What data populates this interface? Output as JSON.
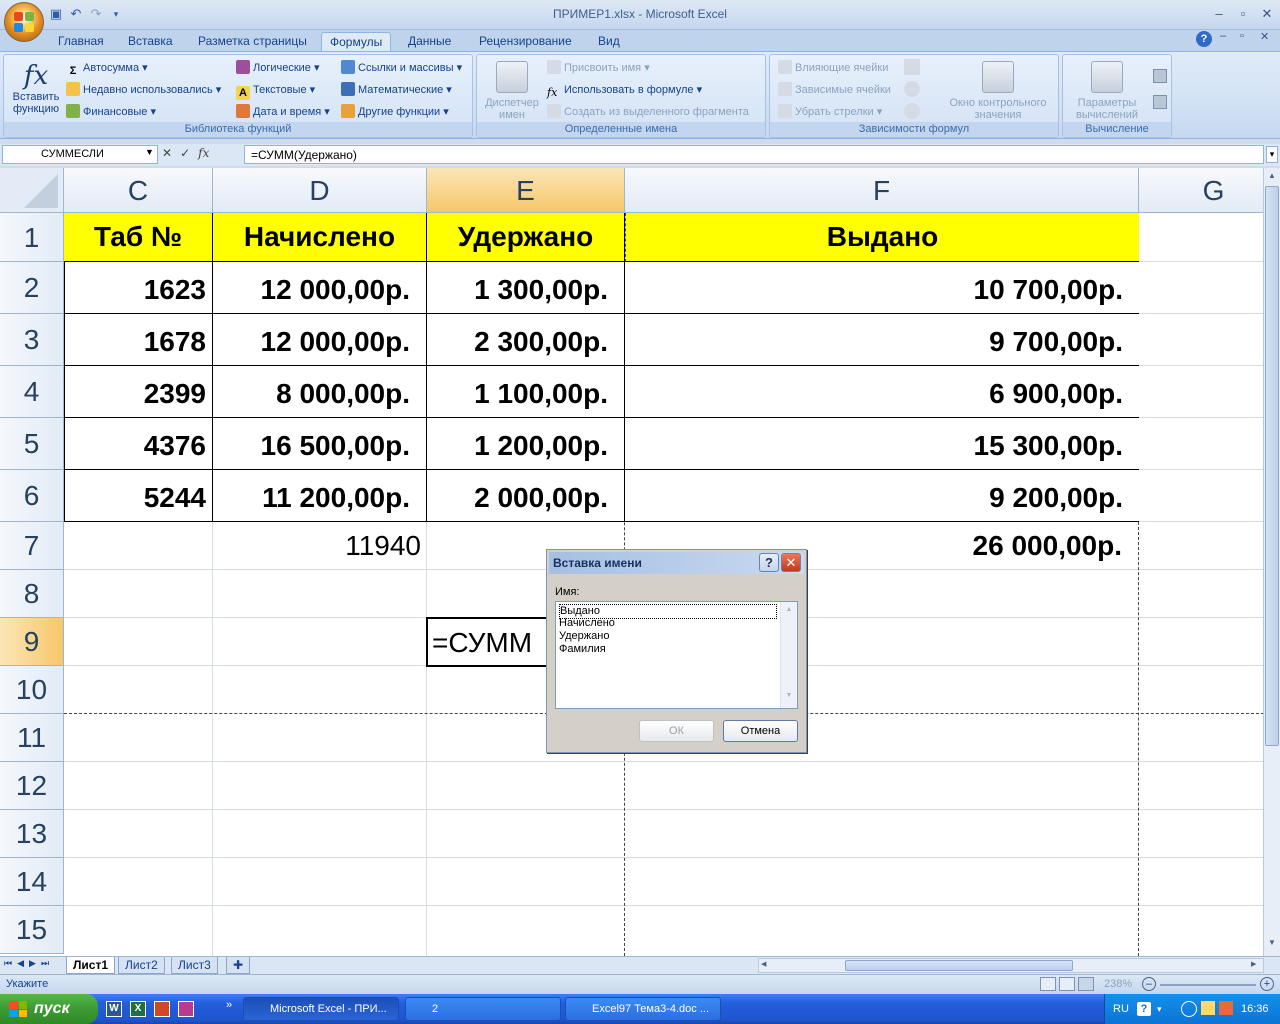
{
  "window": {
    "title": "ПРИМЕР1.xlsx - Microsoft Excel"
  },
  "ribbon_tabs": [
    "Главная",
    "Вставка",
    "Разметка страницы",
    "Формулы",
    "Данные",
    "Рецензирование",
    "Вид"
  ],
  "active_tab": "Формулы",
  "groups": {
    "function_library": {
      "label": "Библиотека функций",
      "insert_function": "Вставить функцию",
      "autosum": "Автосумма",
      "recent": "Недавно использовались",
      "financial": "Финансовые",
      "logical": "Логические",
      "text": "Текстовые",
      "datetime": "Дата и время",
      "lookup": "Ссылки и массивы",
      "math": "Математические",
      "other": "Другие функции"
    },
    "defined_names": {
      "label": "Определенные имена",
      "manager": "Диспетчер имен",
      "define": "Присвоить имя",
      "use_in_formula": "Использовать в формуле",
      "create_from_selection": "Создать из выделенного фрагмента"
    },
    "formula_auditing": {
      "label": "Зависимости формул",
      "precedents": "Влияющие ячейки",
      "dependents": "Зависимые ячейки",
      "remove_arrows": "Убрать стрелки",
      "watch_window": "Окно контрольного значения"
    },
    "calculation": {
      "label": "Вычисление",
      "options": "Параметры вычислений"
    }
  },
  "formula_bar": {
    "name_box": "СУММЕСЛИ",
    "formula": "=СУММ(Удержано)"
  },
  "columns": [
    "C",
    "D",
    "E",
    "F",
    "G"
  ],
  "rows": [
    "1",
    "2",
    "3",
    "4",
    "5",
    "6",
    "7",
    "8",
    "9",
    "10",
    "11",
    "12",
    "13",
    "14",
    "15"
  ],
  "table": {
    "headers": [
      "Таб №",
      "Начислено",
      "Удержано",
      "Выдано"
    ],
    "rows": [
      [
        "1623",
        "12 000,00р.",
        "1 300,00р.",
        "10 700,00р."
      ],
      [
        "1678",
        "12 000,00р.",
        "2 300,00р.",
        "9 700,00р."
      ],
      [
        "2399",
        "8 000,00р.",
        "1 100,00р.",
        "6 900,00р."
      ],
      [
        "4376",
        "16 500,00р.",
        "1 200,00р.",
        "15 300,00р."
      ],
      [
        "5244",
        "11 200,00р.",
        "2 000,00р.",
        "9 200,00р."
      ]
    ],
    "d7": "11940",
    "f7": "26 000,00р.",
    "e9": "=СУММ"
  },
  "dialog": {
    "title": "Вставка имени",
    "help": "?",
    "label": "Имя:",
    "items": [
      "Выдано",
      "Начислено",
      "Удержано",
      "Фамилия"
    ],
    "ok": "ОК",
    "cancel": "Отмена"
  },
  "sheets": [
    "Лист1",
    "Лист2",
    "Лист3"
  ],
  "status": {
    "mode": "Укажите",
    "zoom": "238%"
  },
  "taskbar": {
    "start": "пуск",
    "buttons": [
      "Microsoft Excel - ПРИ...",
      "2",
      "Excel97 Тема3-4.doc ..."
    ],
    "lang": "RU",
    "clock": "16:36"
  }
}
